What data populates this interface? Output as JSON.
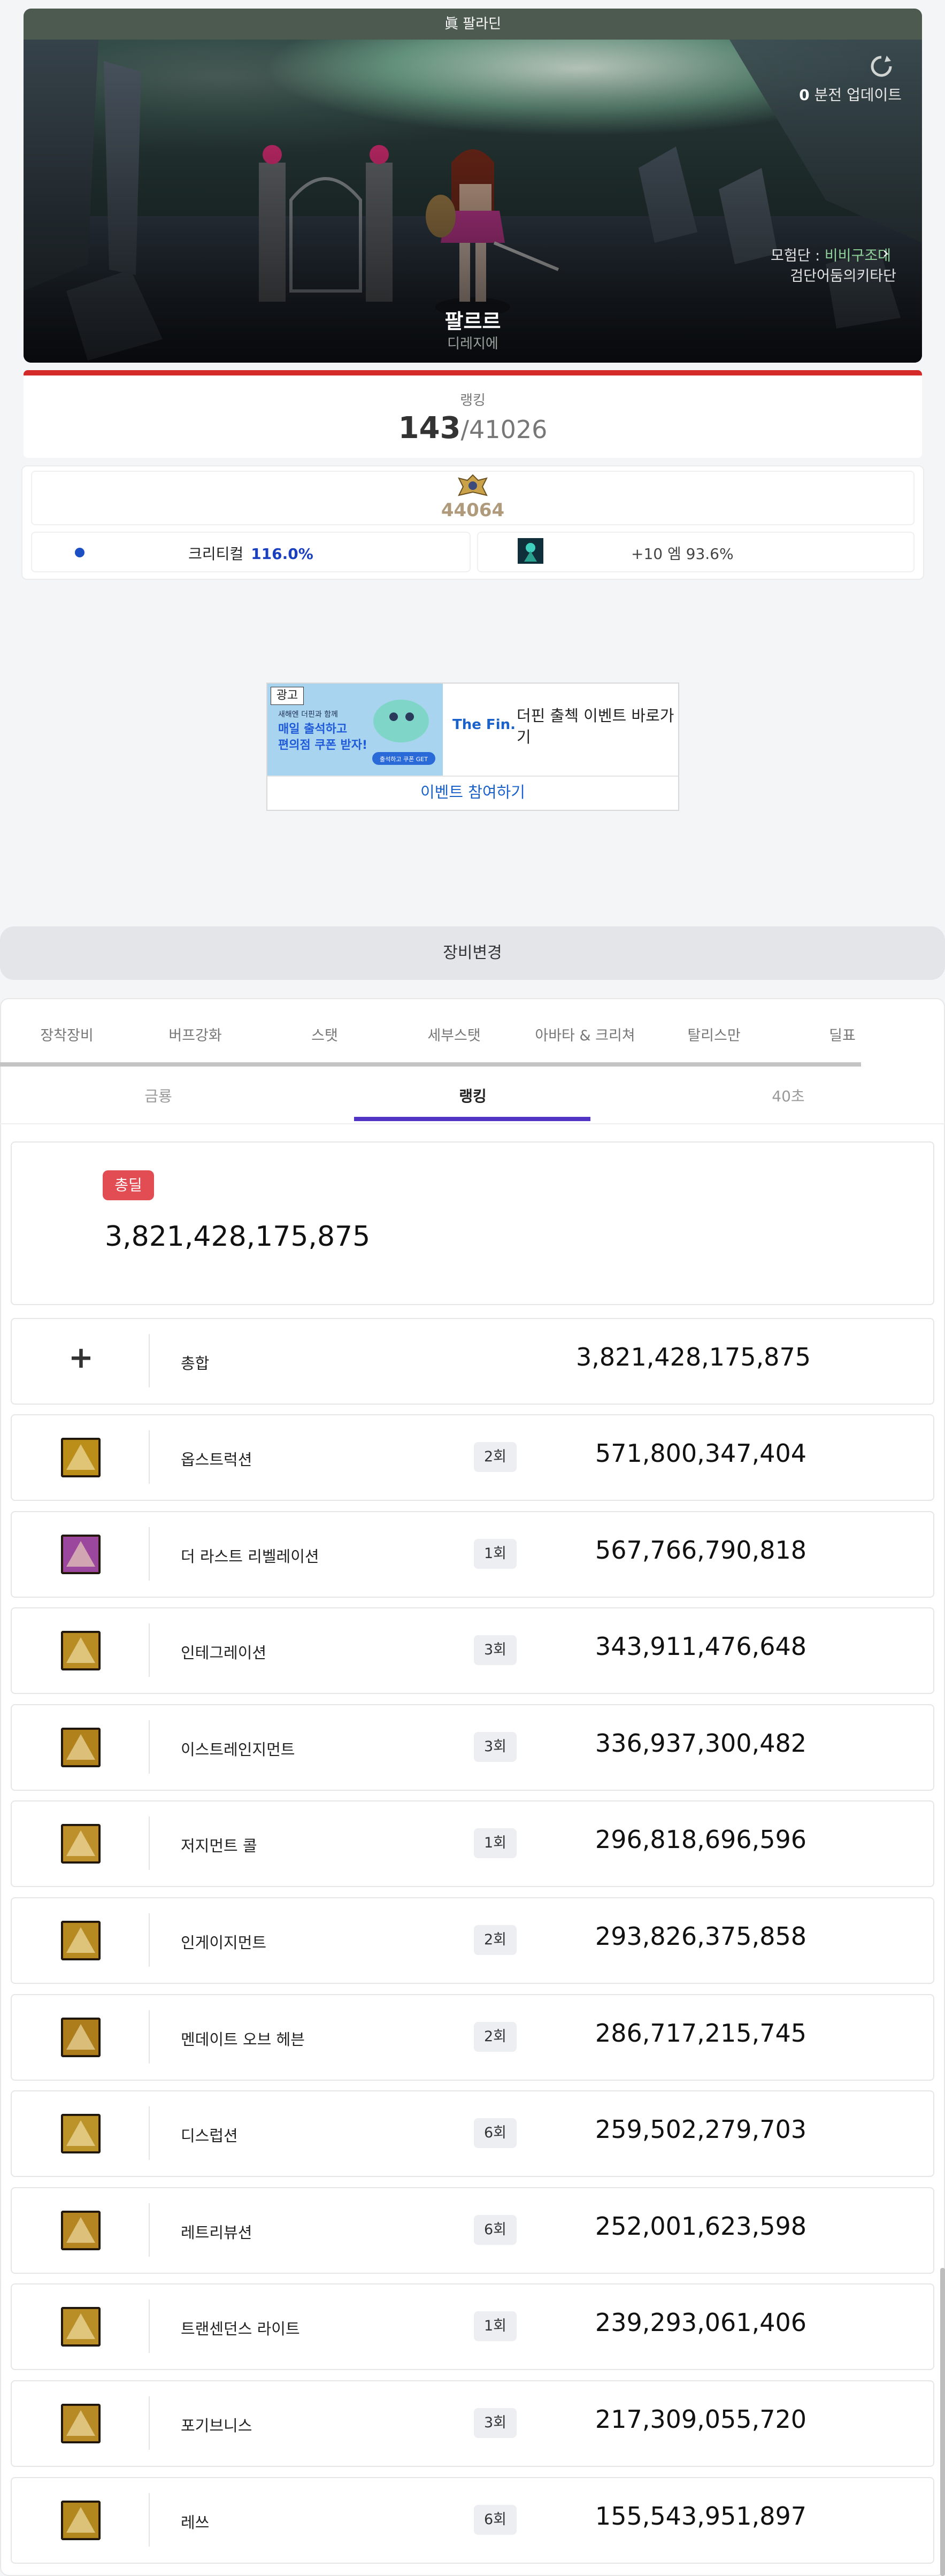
{
  "character": {
    "job_title": "眞 팔라딘",
    "name": "팔르르",
    "server": "디레지에",
    "update_count": "0",
    "update_label": " 분전 업데이트",
    "guild_prefix": "모험단 : ",
    "guild_name": "비비구조대",
    "adventure_label": "검단어둠의키타단"
  },
  "ranking": {
    "label": "랭킹",
    "rank": "143",
    "total": "/41026"
  },
  "union": {
    "level": "44064",
    "crit_label": "크리티컬",
    "crit_value": "116.0%",
    "artifact_text": "+10 엠 93.6%"
  },
  "ad": {
    "label": "광고",
    "banner_line1": "새해엔 더핀과 함께",
    "banner_line2": "매일 출석하고",
    "banner_line3": "편의점 쿠폰 받자!",
    "banner_btn": "출석하고 쿠폰 GET",
    "logo": "The Fin.",
    "text": "더핀 출첵 이벤트 바로가기",
    "cta": "이벤트 참여하기"
  },
  "equip_change_label": "장비변경",
  "tabs_primary": [
    "장착장비",
    "버프강화",
    "스탯",
    "세부스탯",
    "아바타 & 크리쳐",
    "탈리스만",
    "딜표"
  ],
  "tabs_secondary": [
    "금룡",
    "랭킹",
    "40초"
  ],
  "active_secondary": "랭킹",
  "total": {
    "badge": "총딜",
    "value": "3,821,428,175,875"
  },
  "summary_row": {
    "icon": "plus-icon",
    "label": "총합",
    "value": "3,821,428,175,875"
  },
  "skills": [
    {
      "name": "옵스트럭션",
      "hits": "2회",
      "damage": "571,800,347,404",
      "color": "#d4a21c"
    },
    {
      "name": "더 라스트 리벨레이션",
      "hits": "1회",
      "damage": "567,766,790,818",
      "color": "#b04fb8"
    },
    {
      "name": "인테그레이션",
      "hits": "3회",
      "damage": "343,911,476,648",
      "color": "#d2a028"
    },
    {
      "name": "이스트레인지먼트",
      "hits": "3회",
      "damage": "336,937,300,482",
      "color": "#c99320"
    },
    {
      "name": "저지먼트 콜",
      "hits": "1회",
      "damage": "296,818,696,596",
      "color": "#d8a432"
    },
    {
      "name": "인게이지먼트",
      "hits": "2회",
      "damage": "293,826,375,858",
      "color": "#cf9c26"
    },
    {
      "name": "멘데이트 오브 헤븐",
      "hits": "2회",
      "damage": "286,717,215,745",
      "color": "#c48e1e"
    },
    {
      "name": "디스럽션",
      "hits": "6회",
      "damage": "259,502,279,703",
      "color": "#d6a82e"
    },
    {
      "name": "레트리뷰션",
      "hits": "6회",
      "damage": "252,001,623,598",
      "color": "#cd9824"
    },
    {
      "name": "트랜센던스 라이트",
      "hits": "1회",
      "damage": "239,293,061,406",
      "color": "#d4a22c"
    },
    {
      "name": "포기브니스",
      "hits": "3회",
      "damage": "217,309,055,720",
      "color": "#d09e2a"
    },
    {
      "name": "레쓰",
      "hits": "6회",
      "damage": "155,543,951,897",
      "color": "#c99a22"
    }
  ]
}
